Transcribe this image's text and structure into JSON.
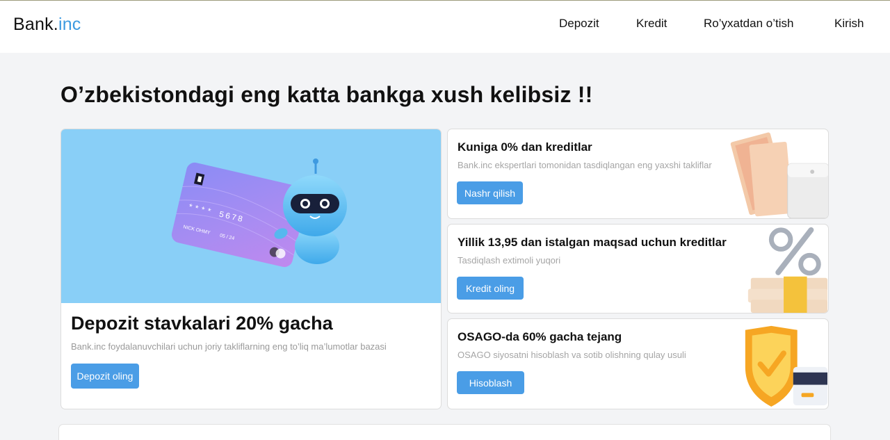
{
  "header": {
    "logo_main": "Bank.",
    "logo_accent": "inc",
    "nav": [
      "Depozit",
      "Kredit",
      "Ro’yxatdan o’tish",
      "Kirish"
    ]
  },
  "hero": {
    "headline": "O’zbekistondagi eng katta bankga xush kelibsiz !!",
    "card_number": "**** 5678",
    "card_holder": "NICK OHMY",
    "card_expiry": "05 / 24"
  },
  "main_card": {
    "title": "Depozit stavkalari 20% gacha",
    "subtitle": "Bank.inc foydalanuvchilari uchun joriy takliflarning eng to’liq ma’lumotlar bazasi",
    "button": "Depozit oling"
  },
  "offers": [
    {
      "title": "Kuniga 0% dan kreditlar",
      "subtitle": "Bank.inc ekspertlari tomonidan tasdiqlangan eng yaxshi takliflar",
      "button": "Nashr qilish"
    },
    {
      "title": "Yillik 13,95 dan istalgan maqsad uchun kreditlar",
      "subtitle": "Tasdiqlash extimoli yuqori",
      "button": "Kredit oling"
    },
    {
      "title": "OSAGO-da 60% gacha tejang",
      "subtitle": "OSAGO siyosatni hisoblash va sotib olishning qulay usuli",
      "button": "Hisoblash"
    }
  ],
  "colors": {
    "accent": "#4a9de6",
    "hero_bg": "#89cff7",
    "logo_accent": "#3d9ae0"
  }
}
